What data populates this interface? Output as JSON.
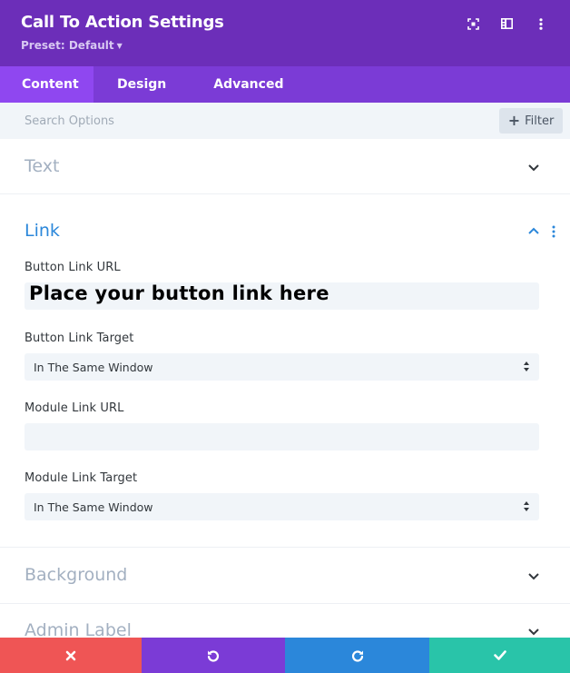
{
  "header": {
    "title": "Call To Action Settings",
    "preset_label": "Preset: Default",
    "icons": [
      "fullscreen-icon",
      "split-view-icon",
      "more-vertical-icon"
    ],
    "bg_color": "#6c2eb9"
  },
  "tabs": [
    {
      "label": "Content",
      "active": true
    },
    {
      "label": "Design",
      "active": false
    },
    {
      "label": "Advanced",
      "active": false
    }
  ],
  "search": {
    "placeholder": "Search Options",
    "value": "",
    "filter_label": "Filter"
  },
  "sections": {
    "text": {
      "title": "Text",
      "expanded": false
    },
    "link": {
      "title": "Link",
      "expanded": true,
      "button_link_url_label": "Button Link URL",
      "button_link_url_value": "Place your button link here",
      "button_link_target_label": "Button Link Target",
      "button_link_target_value": "In The Same Window",
      "module_link_url_label": "Module Link URL",
      "module_link_url_value": "",
      "module_link_target_label": "Module Link Target",
      "module_link_target_value": "In The Same Window"
    },
    "background": {
      "title": "Background",
      "expanded": false
    },
    "admin_label": {
      "title": "Admin Label",
      "expanded": false
    }
  },
  "footer": {
    "buttons": [
      "cancel",
      "undo",
      "redo",
      "save"
    ],
    "colors": {
      "cancel": "#ef5555",
      "undo": "#7b3bd6",
      "redo": "#2b87da",
      "save": "#29c4a9"
    }
  },
  "accent_color": "#2b87da"
}
